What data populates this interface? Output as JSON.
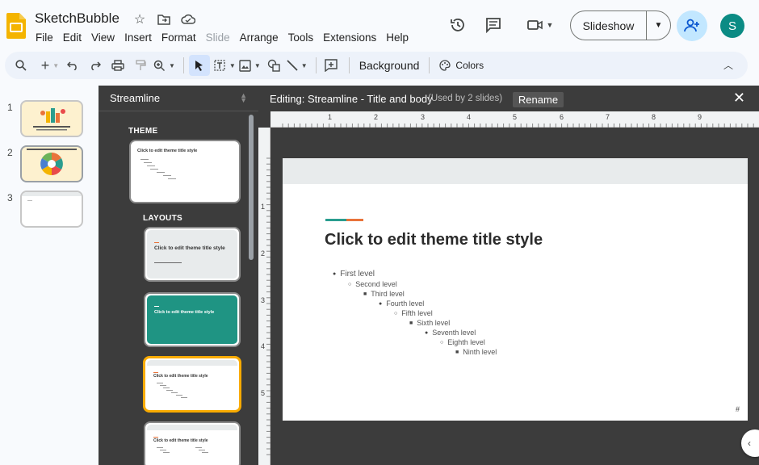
{
  "app": {
    "doc_title": "SketchBubble"
  },
  "menu": [
    "File",
    "Edit",
    "View",
    "Insert",
    "Format",
    "Slide",
    "Arrange",
    "Tools",
    "Extensions",
    "Help"
  ],
  "header": {
    "slideshow_label": "Slideshow",
    "avatar_letter": "S"
  },
  "toolbar": {
    "background_label": "Background",
    "colors_label": "Colors"
  },
  "filmstrip": {
    "slides": [
      "1",
      "2",
      "3"
    ]
  },
  "theme_panel": {
    "theme_name": "Streamline",
    "theme_section": "THEME",
    "layouts_section": "LAYOUTS",
    "thumb_title": "Click to edit theme title style"
  },
  "editor": {
    "title": "Editing: Streamline - Title and body",
    "used_by": "(Used by 2 slides)",
    "rename_label": "Rename",
    "ruler_top": [
      "1",
      "2",
      "3",
      "4",
      "5",
      "6",
      "7",
      "8",
      "9"
    ],
    "ruler_left": [
      "1",
      "2",
      "3",
      "4",
      "5"
    ],
    "slide_title": "Click to edit theme title style",
    "levels": [
      "First level",
      "Second level",
      "Third level",
      "Fourth level",
      "Fifth level",
      "Sixth level",
      "Seventh level",
      "Eighth level",
      "Ninth level"
    ],
    "slide_number": "#"
  },
  "colors": {
    "accent_teal": "#2a9d8f",
    "accent_orange": "#e9733a",
    "selection": "#f9ab00",
    "avatar": "#0b8b84"
  }
}
